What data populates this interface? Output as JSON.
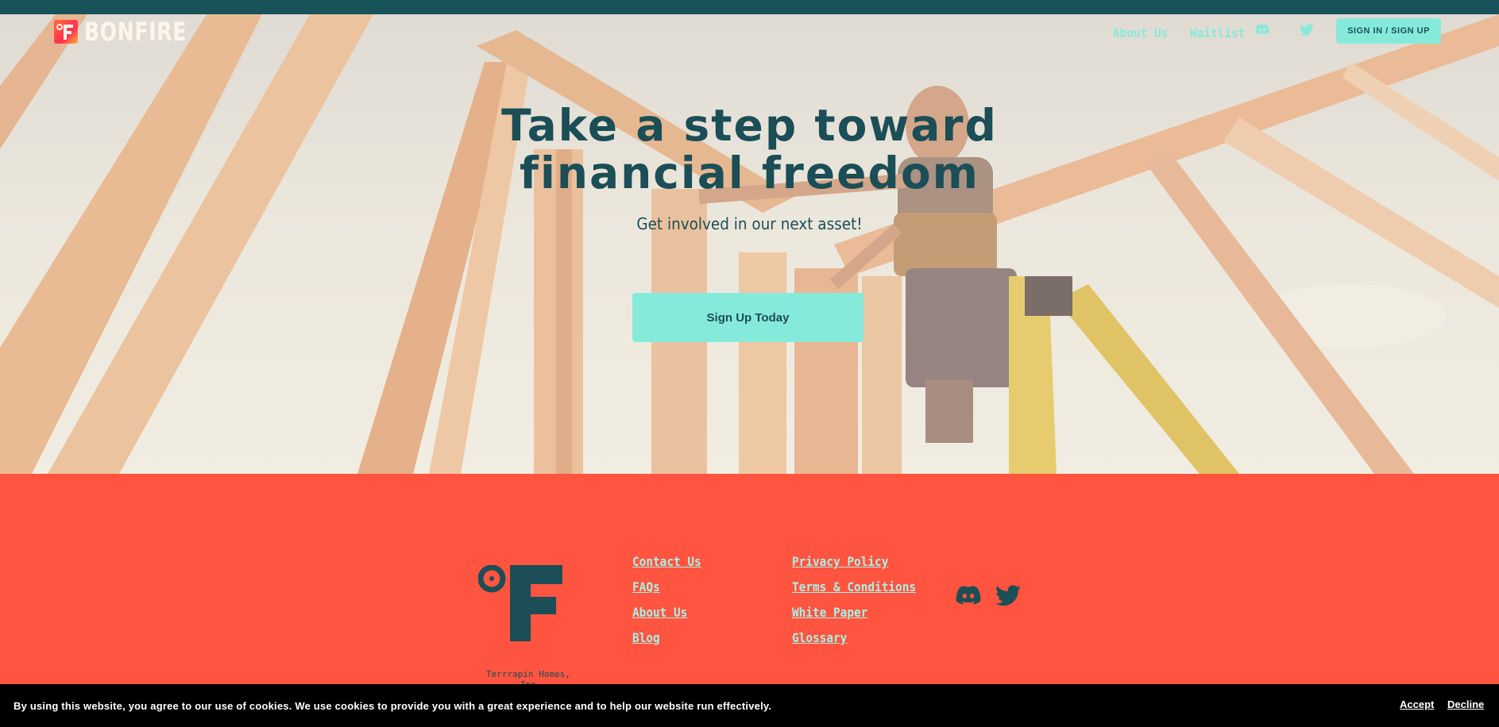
{
  "brand": {
    "name": "BONFIRE",
    "logo_icon": "bonfire-logo-icon"
  },
  "nav": {
    "links": [
      {
        "label": "About Us"
      },
      {
        "label": "Waitlist"
      }
    ],
    "icons": [
      "discord-icon",
      "twitter-icon"
    ],
    "signin_label": "SIGN IN / SIGN UP"
  },
  "hero": {
    "headline_line1": "Take a step toward",
    "headline_line2": "financial freedom",
    "subheadline": "Get involved in our next asset!",
    "cta_label": "Sign Up Today"
  },
  "footer": {
    "company": "Terrrapin Homes, Inc",
    "col1": [
      {
        "label": "Contact Us"
      },
      {
        "label": "FAQs"
      },
      {
        "label": "About Us"
      },
      {
        "label": "Blog"
      }
    ],
    "col2": [
      {
        "label": "Privacy Policy"
      },
      {
        "label": "Terms & Conditions"
      },
      {
        "label": "White Paper"
      },
      {
        "label": "Glossary"
      }
    ],
    "social_icons": [
      "discord-icon",
      "twitter-icon"
    ]
  },
  "cookie": {
    "message": "By using this website, you agree to our use of cookies. We use cookies to provide you with a great experience and to help our website run effectively.",
    "accept_label": "Accept",
    "decline_label": "Decline"
  },
  "colors": {
    "topbar": "#18535a",
    "accent": "#86eadb",
    "footer_bg": "#ff5440",
    "text_dark": "#1b4e56"
  }
}
